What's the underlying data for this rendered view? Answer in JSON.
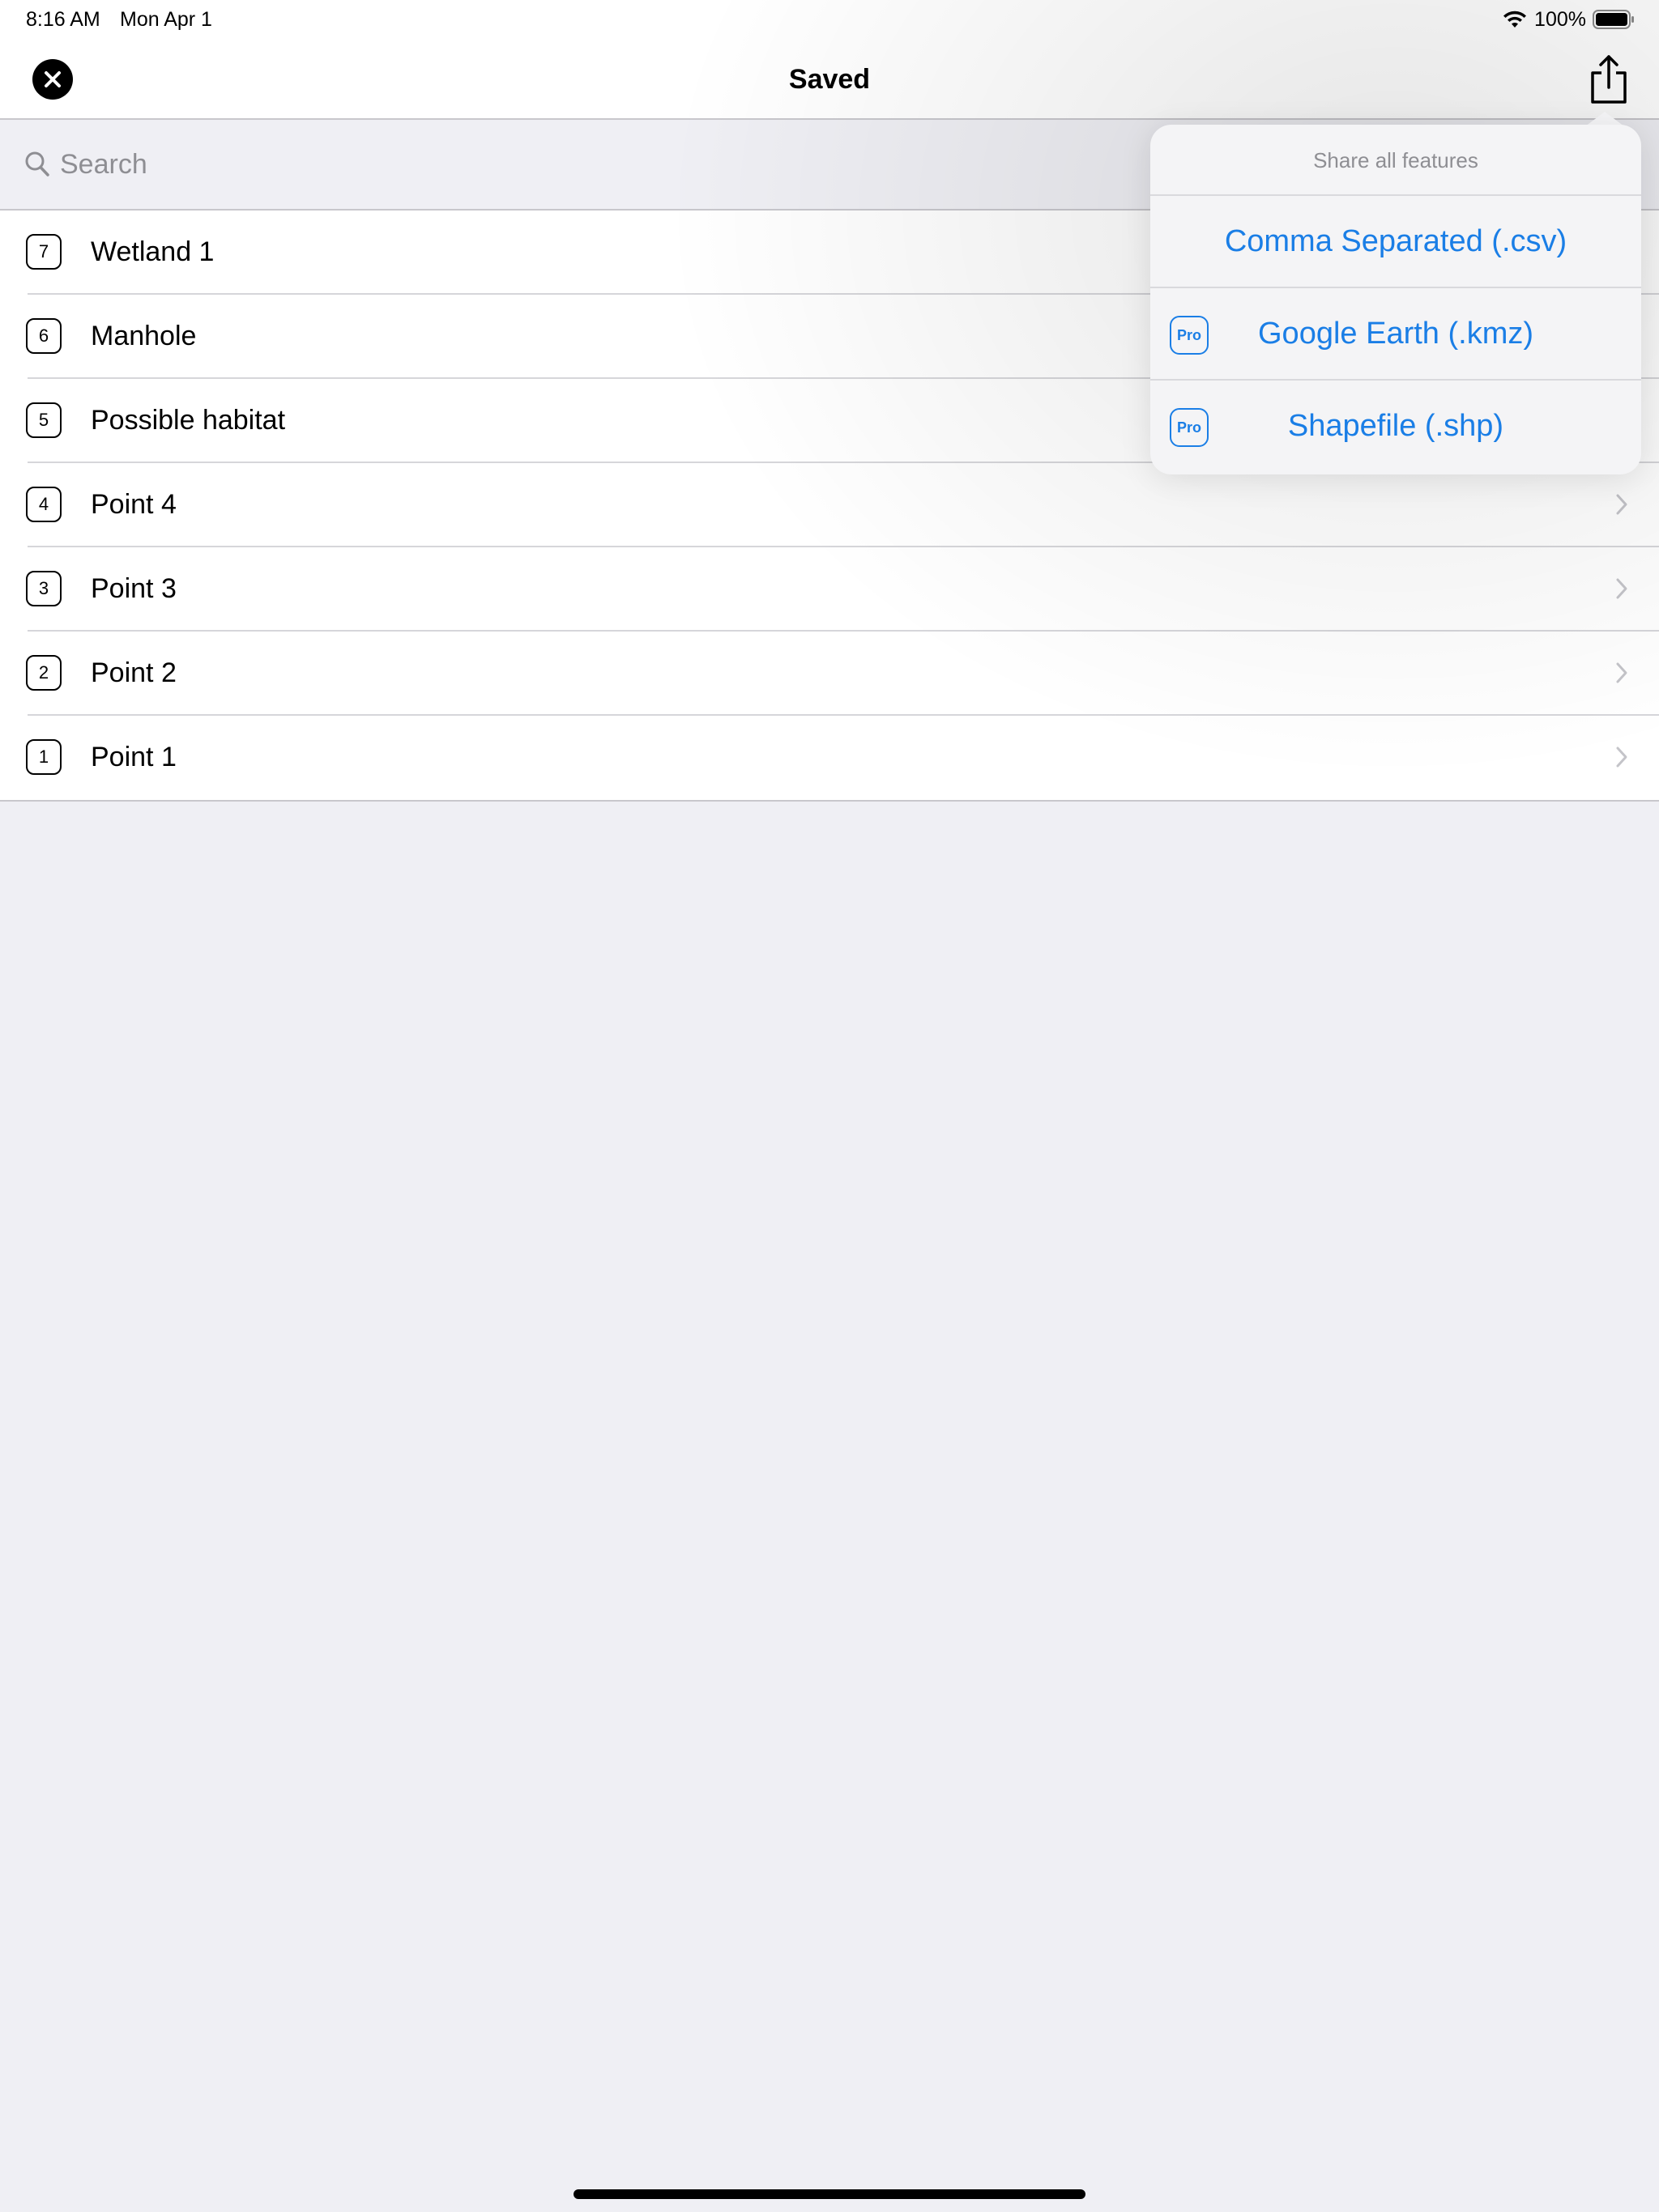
{
  "status_bar": {
    "time": "8:16 AM",
    "date": "Mon Apr 1",
    "battery_text": "100%",
    "battery_level": 1.0
  },
  "nav": {
    "title": "Saved",
    "close_icon": "close-circle-icon",
    "share_icon": "share-icon"
  },
  "search": {
    "placeholder": "Search",
    "value": ""
  },
  "features": [
    {
      "number": "7",
      "label": "Wetland 1"
    },
    {
      "number": "6",
      "label": "Manhole"
    },
    {
      "number": "5",
      "label": "Possible habitat"
    },
    {
      "number": "4",
      "label": "Point 4"
    },
    {
      "number": "3",
      "label": "Point 3"
    },
    {
      "number": "2",
      "label": "Point 2"
    },
    {
      "number": "1",
      "label": "Point 1"
    }
  ],
  "share_popover": {
    "header": "Share all features",
    "options": [
      {
        "label": "Comma Separated (.csv)",
        "pro": ""
      },
      {
        "label": "Google Earth (.kmz)",
        "pro": "Pro"
      },
      {
        "label": "Shapefile (.shp)",
        "pro": "Pro"
      }
    ]
  },
  "colors": {
    "accent": "#1a7ee6",
    "background": "#efeff4",
    "separator": "#c8c7cc"
  }
}
